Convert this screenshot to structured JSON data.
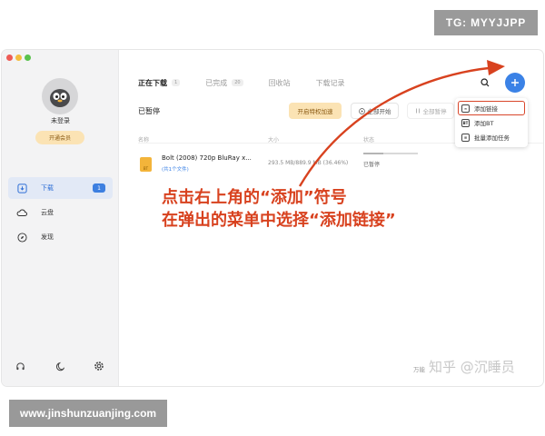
{
  "watermark_top": "TG: MYYJJPP",
  "watermark_bottom": "www.jinshunzuanjing.com",
  "sidebar": {
    "username": "未登录",
    "vip_button": "开通会员",
    "items": [
      {
        "label": "下载",
        "badge": "1",
        "icon": "download-icon"
      },
      {
        "label": "云盘",
        "icon": "cloud-icon"
      },
      {
        "label": "发现",
        "icon": "compass-icon"
      }
    ]
  },
  "tabs": [
    {
      "label": "正在下载",
      "count": "1"
    },
    {
      "label": "已完成",
      "count": "20"
    },
    {
      "label": "回收站"
    },
    {
      "label": "下载记录"
    }
  ],
  "section_title": "已暂停",
  "toolbar": {
    "accelerate": "开启特权加速",
    "start_all": "全部开始",
    "pause_all": "全部暂停"
  },
  "columns": {
    "name": "名称",
    "size": "大小",
    "status": "状态"
  },
  "file": {
    "name": "Bolt (2008) 720p BluRay x...",
    "count": "(共1个文件)",
    "size": "293.5 MB/889.9 MB (36.46%)",
    "status": "已暂停",
    "progress": 0.3646,
    "icon_text": "BT"
  },
  "add_menu": [
    {
      "label": "添加链接",
      "icon": "link-icon"
    },
    {
      "label": "添加BT",
      "icon": "bt-icon",
      "icon_text": "BT"
    },
    {
      "label": "批量添加任务",
      "icon": "batch-icon"
    }
  ],
  "footer_text": "万能",
  "zhihu_watermark": "知乎 @沉睡员",
  "annotation": {
    "line1": "点击右上角的“添加”符号",
    "line2": "在弹出的菜单中选择“添加链接”"
  },
  "colors": {
    "accent": "#3b82e6",
    "annotation": "#d8421f",
    "highlight": "#d9462a"
  }
}
